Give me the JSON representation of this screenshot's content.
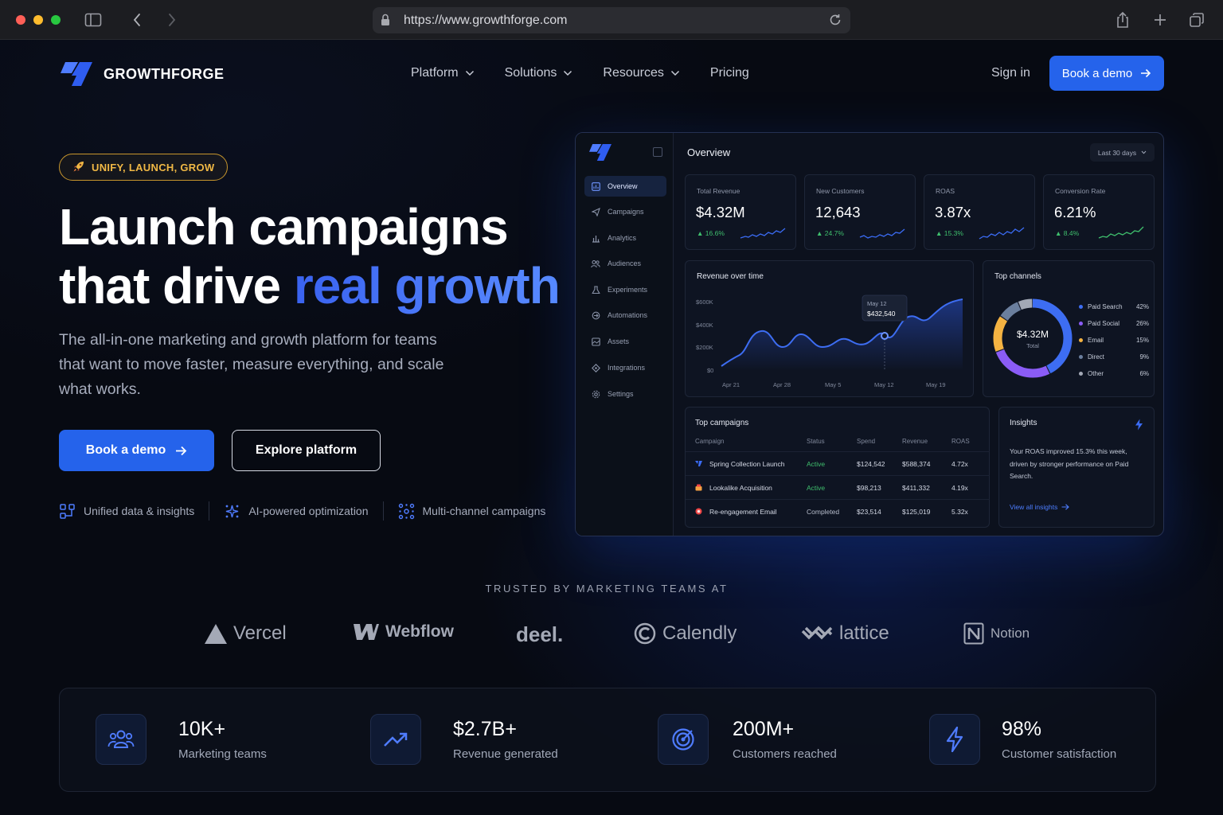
{
  "browser": {
    "url": "https://www.growthforge.com"
  },
  "brand": {
    "name": "GROWTHFORGE"
  },
  "nav": {
    "items": [
      {
        "label": "Platform",
        "has_dropdown": true
      },
      {
        "label": "Solutions",
        "has_dropdown": true
      },
      {
        "label": "Resources",
        "has_dropdown": true
      },
      {
        "label": "Pricing",
        "has_dropdown": false
      }
    ],
    "sign_in": "Sign in",
    "cta": "Book a demo"
  },
  "hero": {
    "badge": "UNIFY, LAUNCH, GROW",
    "title_line1": "Launch campaigns",
    "title_line2_plain": "that drive ",
    "title_line2_accent": "real growth",
    "subtitle": "The all-in-one marketing and growth platform for teams that want to move faster, measure everything, and scale what works.",
    "primary_cta": "Book a demo",
    "secondary_cta": "Explore platform",
    "features": [
      {
        "label": "Unified data & insights",
        "icon": "unified-data-icon"
      },
      {
        "label": "AI-powered optimization",
        "icon": "ai-sparkle-icon"
      },
      {
        "label": "Multi-channel campaigns",
        "icon": "multichannel-icon"
      }
    ]
  },
  "dashboard": {
    "title": "Overview",
    "range": "Last 30 days",
    "sidebar": [
      {
        "label": "Overview",
        "icon": "overview-icon",
        "active": true
      },
      {
        "label": "Campaigns",
        "icon": "send-icon"
      },
      {
        "label": "Analytics",
        "icon": "bar-chart-icon"
      },
      {
        "label": "Audiences",
        "icon": "users-icon"
      },
      {
        "label": "Experiments",
        "icon": "flask-icon"
      },
      {
        "label": "Automations",
        "icon": "automation-icon"
      },
      {
        "label": "Assets",
        "icon": "folder-icon"
      },
      {
        "label": "Integrations",
        "icon": "puzzle-icon"
      },
      {
        "label": "Settings",
        "icon": "gear-icon"
      }
    ],
    "kpis": [
      {
        "label": "Total Revenue",
        "value": "$4.32M",
        "change": "16.6%",
        "color": "#3b6cf5"
      },
      {
        "label": "New Customers",
        "value": "12,643",
        "change": "24.7%",
        "color": "#3b6cf5"
      },
      {
        "label": "ROAS",
        "value": "3.87x",
        "change": "15.3%",
        "color": "#3b6cf5"
      },
      {
        "label": "Conversion Rate",
        "value": "6.21%",
        "change": "8.4%",
        "color": "#3fbf6d"
      }
    ],
    "revenue_chart": {
      "title": "Revenue over time",
      "y_ticks": [
        "$600K",
        "$400K",
        "$200K",
        "$0"
      ],
      "x_ticks": [
        "Apr 21",
        "Apr 28",
        "May 5",
        "May 12",
        "May 19"
      ],
      "tooltip_date": "May 12",
      "tooltip_value": "$432,540"
    },
    "channels": {
      "title": "Top channels",
      "total": "$4.32M",
      "total_label": "Total",
      "items": [
        {
          "name": "Paid Search",
          "pct": "42%",
          "color": "#3d6df2"
        },
        {
          "name": "Paid Social",
          "pct": "26%",
          "color": "#8b5cf6"
        },
        {
          "name": "Email",
          "pct": "15%",
          "color": "#f5b342"
        },
        {
          "name": "Direct",
          "pct": "9%",
          "color": "#6b7f9e"
        },
        {
          "name": "Other",
          "pct": "6%",
          "color": "#a3a9b6"
        }
      ]
    },
    "campaigns": {
      "title": "Top campaigns",
      "headers": [
        "Campaign",
        "Status",
        "Spend",
        "Revenue",
        "ROAS"
      ],
      "rows": [
        {
          "name": "Spring Collection Launch",
          "status": "Active",
          "spend": "$124,542",
          "revenue": "$588,374",
          "roas": "4.72x",
          "icon_color": "#3b6cf5"
        },
        {
          "name": "Lookalike Acquisition",
          "status": "Active",
          "spend": "$98,213",
          "revenue": "$411,332",
          "roas": "4.19x",
          "icon_color": "#f5a142"
        },
        {
          "name": "Re-engagement Email",
          "status": "Completed",
          "spend": "$23,514",
          "revenue": "$125,019",
          "roas": "5.32x",
          "icon_color": "#ef4444"
        }
      ]
    },
    "insights": {
      "title": "Insights",
      "text": "Your ROAS improved 15.3% this week, driven by stronger performance on Paid Search.",
      "link": "View all insights"
    }
  },
  "trusted": {
    "label": "TRUSTED BY MARKETING TEAMS AT",
    "logos": [
      "Vercel",
      "Webflow",
      "deel.",
      "Calendly",
      "lattice",
      "Notion"
    ]
  },
  "stats": [
    {
      "value": "10K+",
      "label": "Marketing teams",
      "icon": "team-icon"
    },
    {
      "value": "$2.7B+",
      "label": "Revenue generated",
      "icon": "trend-up-icon"
    },
    {
      "value": "200M+",
      "label": "Customers reached",
      "icon": "target-icon"
    },
    {
      "value": "98%",
      "label": "Customer satisfaction",
      "icon": "bolt-icon"
    }
  ]
}
